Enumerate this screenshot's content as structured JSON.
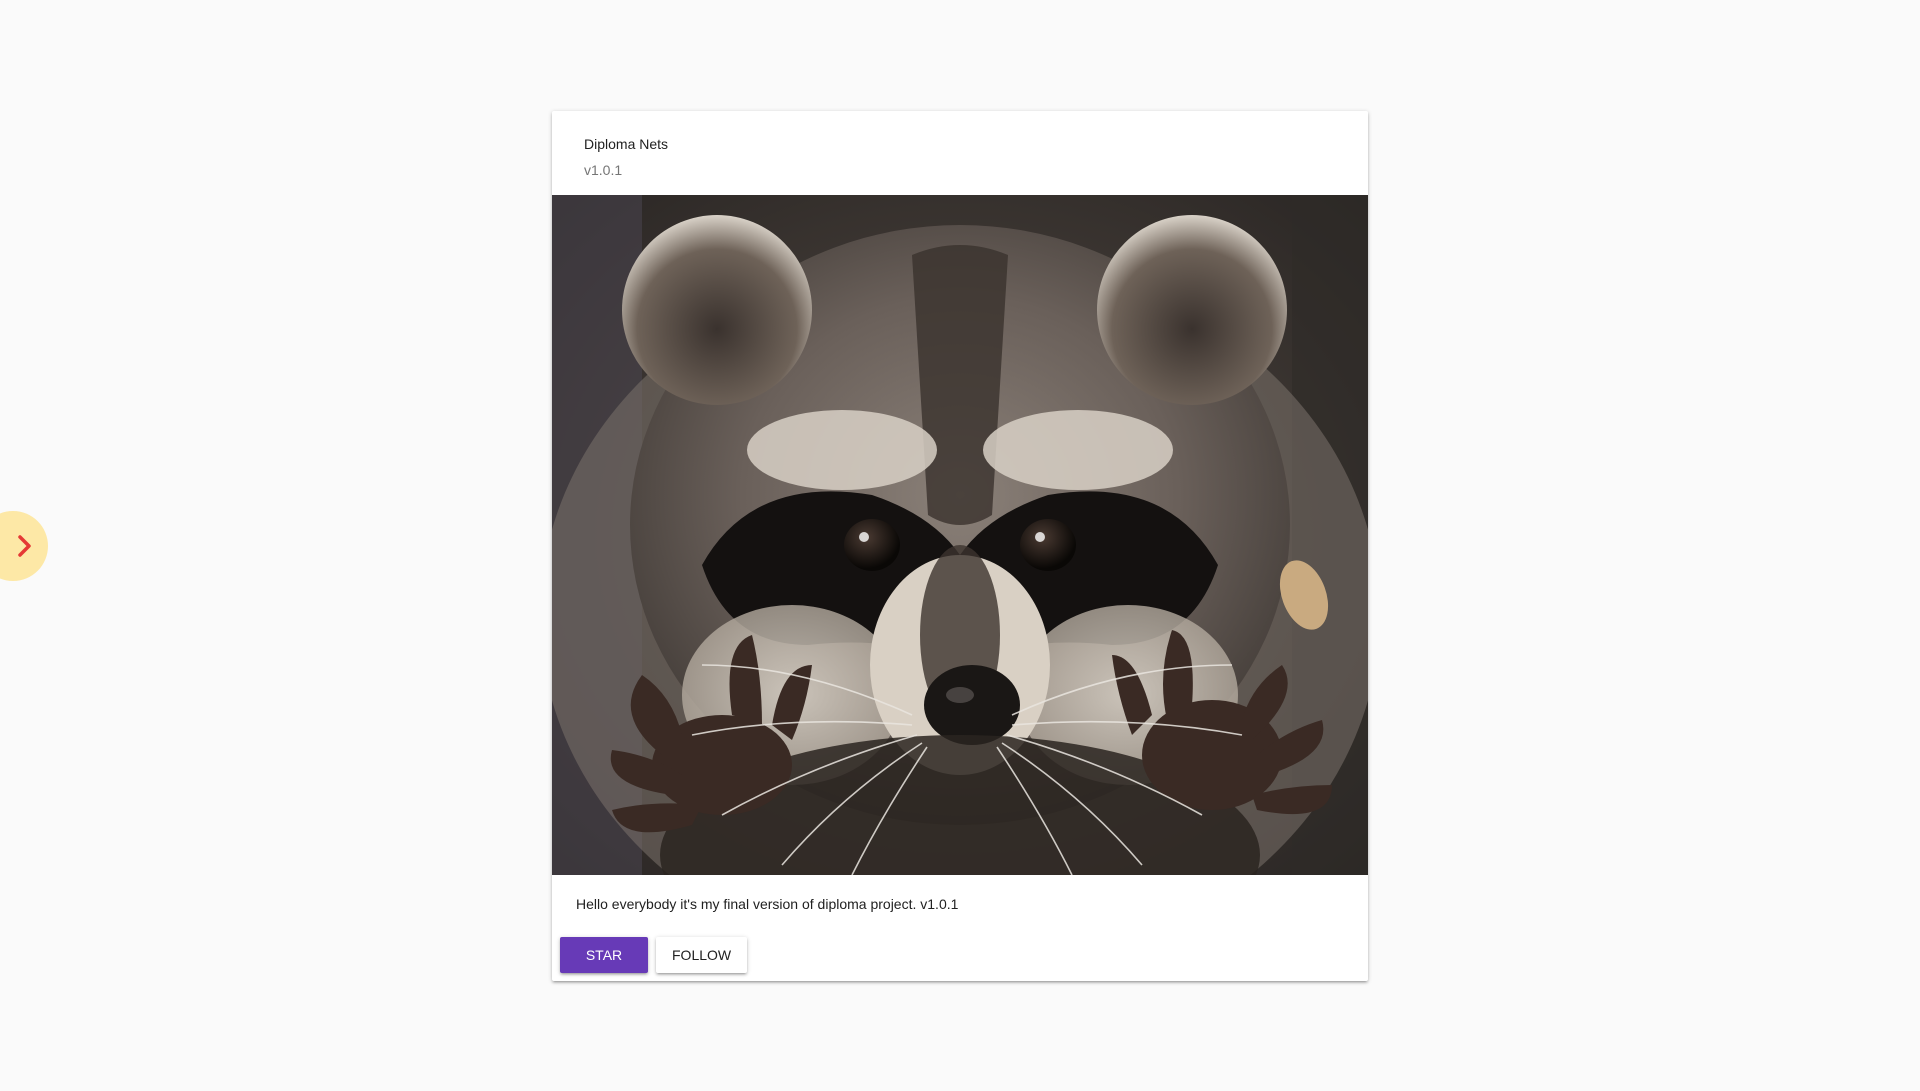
{
  "sidebar_toggle": {
    "icon": "chevron-right-icon",
    "background_color": "#fde8a6",
    "icon_color": "#e53935"
  },
  "card": {
    "title": "Diploma Nets",
    "subtitle": "v1.0.1",
    "image": "raccoon-photo",
    "text": "Hello everybody it's my final version of diploma project. v1.0.1",
    "actions": {
      "star_label": "Star",
      "follow_label": "Follow"
    },
    "accent_color": "#673ab7"
  }
}
